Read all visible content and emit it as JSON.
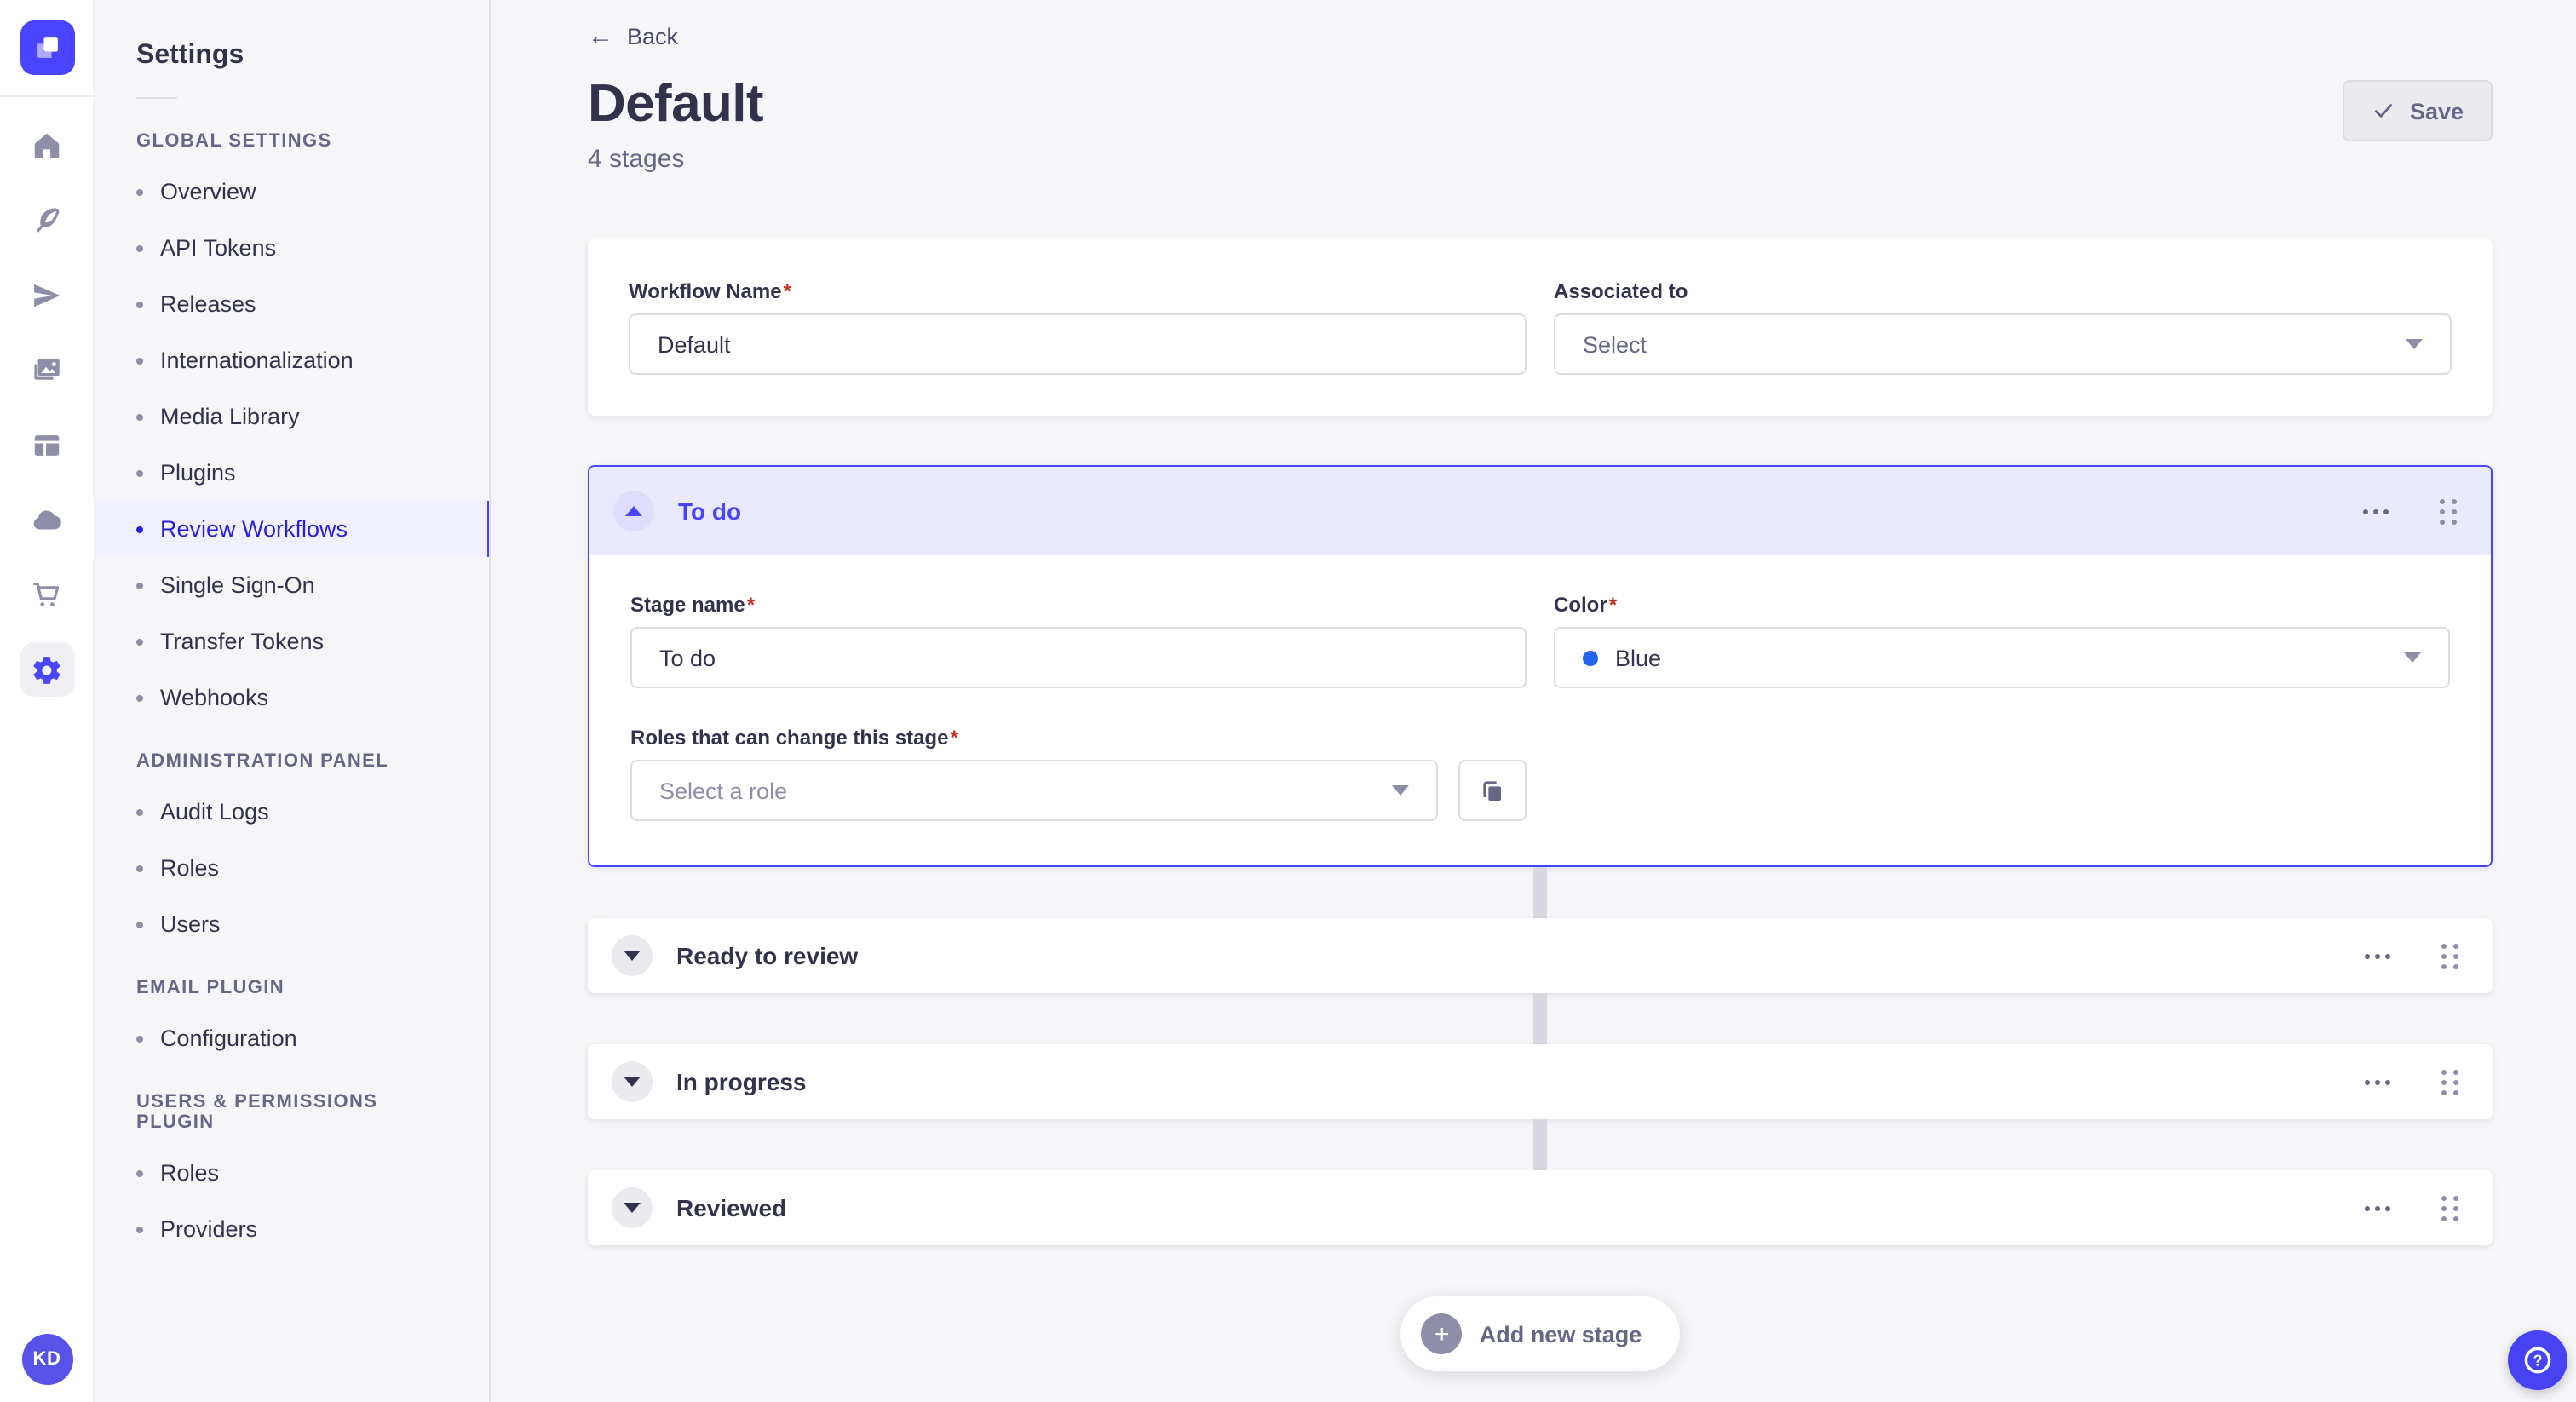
{
  "rail": {
    "logo": "strapi-logo",
    "items": [
      {
        "name": "home-icon"
      },
      {
        "name": "content-manager-feather-icon"
      },
      {
        "name": "releases-paper-plane-icon"
      },
      {
        "name": "media-library-icon"
      },
      {
        "name": "content-type-builder-icon"
      },
      {
        "name": "deploy-cloud-icon"
      },
      {
        "name": "marketplace-cart-icon"
      },
      {
        "name": "settings-gear-icon",
        "active": true
      }
    ],
    "avatar_initials": "KD"
  },
  "sidebar": {
    "title": "Settings",
    "sections": [
      {
        "label": "GLOBAL SETTINGS",
        "items": [
          {
            "label": "Overview",
            "active": false
          },
          {
            "label": "API Tokens",
            "active": false
          },
          {
            "label": "Releases",
            "active": false
          },
          {
            "label": "Internationalization",
            "active": false
          },
          {
            "label": "Media Library",
            "active": false
          },
          {
            "label": "Plugins",
            "active": false
          },
          {
            "label": "Review Workflows",
            "active": true
          },
          {
            "label": "Single Sign-On",
            "active": false
          },
          {
            "label": "Transfer Tokens",
            "active": false
          },
          {
            "label": "Webhooks",
            "active": false
          }
        ]
      },
      {
        "label": "ADMINISTRATION PANEL",
        "items": [
          {
            "label": "Audit Logs",
            "active": false
          },
          {
            "label": "Roles",
            "active": false
          },
          {
            "label": "Users",
            "active": false
          }
        ]
      },
      {
        "label": "EMAIL PLUGIN",
        "items": [
          {
            "label": "Configuration",
            "active": false
          }
        ]
      },
      {
        "label": "USERS & PERMISSIONS PLUGIN",
        "items": [
          {
            "label": "Roles",
            "active": false
          },
          {
            "label": "Providers",
            "active": false
          }
        ]
      }
    ]
  },
  "header": {
    "back_label": "Back",
    "title": "Default",
    "subtitle": "4 stages",
    "save_label": "Save"
  },
  "required_marker": "*",
  "workflow_form": {
    "name_label": "Workflow Name",
    "name_value": "Default",
    "associated_label": "Associated to",
    "associated_placeholder": "Select"
  },
  "stages": {
    "expanded": {
      "title": "To do",
      "stage_name_label": "Stage name",
      "stage_name_value": "To do",
      "color_label": "Color",
      "color_value": "Blue",
      "color_hex": "#2563EB",
      "roles_label": "Roles that can change this stage",
      "roles_placeholder": "Select a role"
    },
    "collapsed": [
      {
        "title": "Ready to review"
      },
      {
        "title": "In progress"
      },
      {
        "title": "Reviewed"
      }
    ]
  },
  "footer": {
    "add_stage_label": "Add new stage"
  },
  "colors": {
    "accent": "#4945FF",
    "active_nav_text": "#271FE0",
    "page_background": "#F6F6F9",
    "required": "#D02B20"
  }
}
